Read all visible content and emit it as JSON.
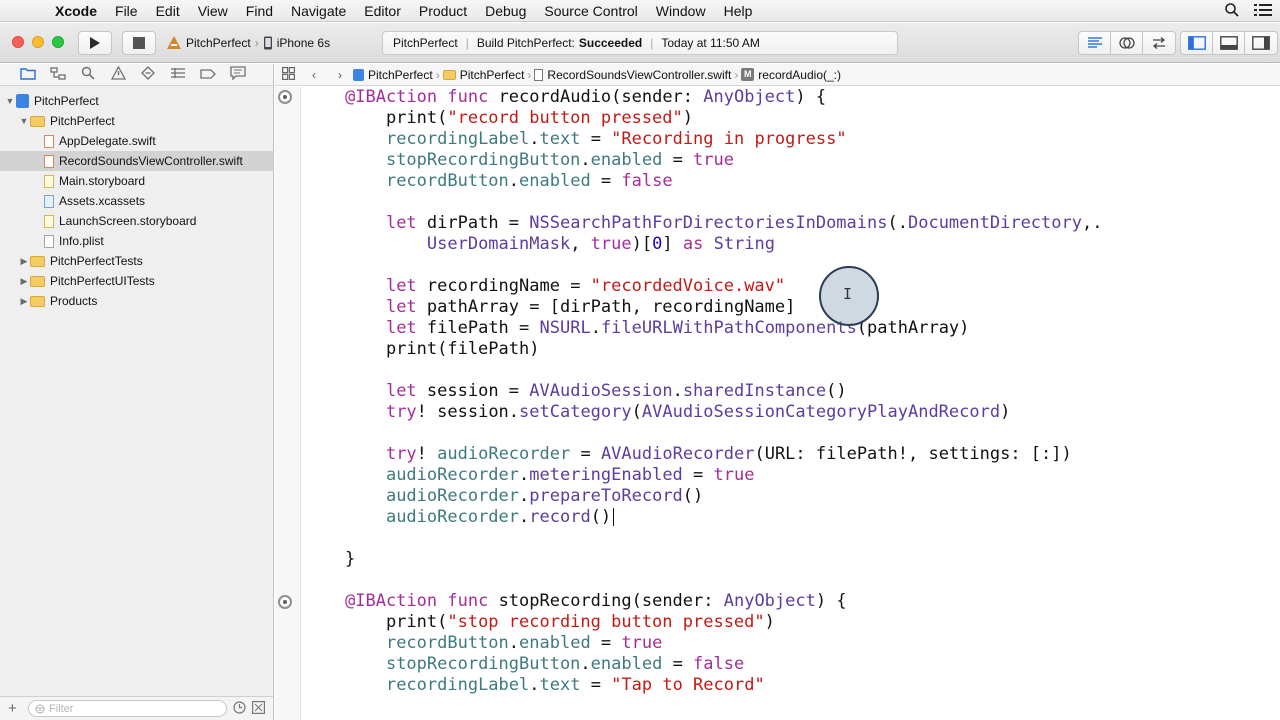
{
  "menubar": {
    "apple_glyph": "",
    "app_name": "Xcode",
    "items": [
      "File",
      "Edit",
      "View",
      "Find",
      "Navigate",
      "Editor",
      "Product",
      "Debug",
      "Source Control",
      "Window",
      "Help"
    ]
  },
  "toolbar": {
    "scheme_target": "PitchPerfect",
    "scheme_device": "iPhone 6s",
    "activity_project": "PitchPerfect",
    "activity_build_label": "Build PitchPerfect:",
    "activity_build_status": "Succeeded",
    "activity_time": "Today at 11:50 AM"
  },
  "navigator": {
    "tree": [
      {
        "label": "PitchPerfect",
        "kind": "project",
        "disclosure": "open",
        "indent": 0
      },
      {
        "label": "PitchPerfect",
        "kind": "folder",
        "disclosure": "open",
        "indent": 1
      },
      {
        "label": "AppDelegate.swift",
        "kind": "swift",
        "disclosure": "",
        "indent": 2
      },
      {
        "label": "RecordSoundsViewController.swift",
        "kind": "swift",
        "disclosure": "",
        "indent": 2,
        "selected": true
      },
      {
        "label": "Main.storyboard",
        "kind": "storyboard",
        "disclosure": "",
        "indent": 2
      },
      {
        "label": "Assets.xcassets",
        "kind": "assets",
        "disclosure": "",
        "indent": 2
      },
      {
        "label": "LaunchScreen.storyboard",
        "kind": "storyboard",
        "disclosure": "",
        "indent": 2
      },
      {
        "label": "Info.plist",
        "kind": "plist",
        "disclosure": "",
        "indent": 2
      },
      {
        "label": "PitchPerfectTests",
        "kind": "folder",
        "disclosure": "closed",
        "indent": 1
      },
      {
        "label": "PitchPerfectUITests",
        "kind": "folder",
        "disclosure": "closed",
        "indent": 1
      },
      {
        "label": "Products",
        "kind": "folder",
        "disclosure": "closed",
        "indent": 1
      }
    ],
    "filter_placeholder": "Filter"
  },
  "jumpbar": {
    "crumbs": [
      "PitchPerfect",
      "PitchPerfect",
      "RecordSoundsViewController.swift",
      "recordAudio(_:)"
    ]
  },
  "editor": {
    "lines": [
      [
        [
          "@IBAction",
          "kw"
        ],
        [
          " ",
          ""
        ],
        [
          "func",
          "kw"
        ],
        [
          " recordAudio(sender: ",
          ""
        ],
        [
          "AnyObject",
          "ty"
        ],
        [
          ") {",
          ""
        ]
      ],
      [
        [
          "    print(",
          ""
        ],
        [
          "\"record button pressed\"",
          "str"
        ],
        [
          ")",
          ""
        ]
      ],
      [
        [
          "    ",
          ""
        ],
        [
          "recordingLabel",
          "prj"
        ],
        [
          ".",
          ""
        ],
        [
          "text",
          "prj"
        ],
        [
          " = ",
          ""
        ],
        [
          "\"Recording in progress\"",
          "str"
        ]
      ],
      [
        [
          "    ",
          ""
        ],
        [
          "stopRecordingButton",
          "prj"
        ],
        [
          ".",
          ""
        ],
        [
          "enabled",
          "prj"
        ],
        [
          " = ",
          ""
        ],
        [
          "true",
          "kw"
        ]
      ],
      [
        [
          "    ",
          ""
        ],
        [
          "recordButton",
          "prj"
        ],
        [
          ".",
          ""
        ],
        [
          "enabled",
          "prj"
        ],
        [
          " = ",
          ""
        ],
        [
          "false",
          "kw"
        ]
      ],
      [],
      [
        [
          "    ",
          ""
        ],
        [
          "let",
          "kw"
        ],
        [
          " dirPath = ",
          ""
        ],
        [
          "NSSearchPathForDirectoriesInDomains",
          "ty"
        ],
        [
          "(.",
          ""
        ],
        [
          "DocumentDirectory",
          "ty"
        ],
        [
          ",.",
          ""
        ]
      ],
      [
        [
          "        ",
          ""
        ],
        [
          "UserDomainMask",
          "ty"
        ],
        [
          ", ",
          ""
        ],
        [
          "true",
          "kw"
        ],
        [
          ")[",
          ""
        ],
        [
          "0",
          "num"
        ],
        [
          "] ",
          ""
        ],
        [
          "as",
          "kw"
        ],
        [
          " ",
          ""
        ],
        [
          "String",
          "ty"
        ]
      ],
      [],
      [
        [
          "    ",
          ""
        ],
        [
          "let",
          "kw"
        ],
        [
          " recordingName = ",
          ""
        ],
        [
          "\"recordedVoice.wav\"",
          "str"
        ]
      ],
      [
        [
          "    ",
          ""
        ],
        [
          "let",
          "kw"
        ],
        [
          " pathArray = [dirPath, recordingName]",
          ""
        ]
      ],
      [
        [
          "    ",
          ""
        ],
        [
          "let",
          "kw"
        ],
        [
          " filePath = ",
          ""
        ],
        [
          "NSURL",
          "ty"
        ],
        [
          ".",
          ""
        ],
        [
          "fileURLWithPathComponents",
          "ty"
        ],
        [
          "(pathArray)",
          ""
        ]
      ],
      [
        [
          "    print(filePath)",
          ""
        ]
      ],
      [],
      [
        [
          "    ",
          ""
        ],
        [
          "let",
          "kw"
        ],
        [
          " session = ",
          ""
        ],
        [
          "AVAudioSession",
          "ty"
        ],
        [
          ".",
          ""
        ],
        [
          "sharedInstance",
          "ty"
        ],
        [
          "()",
          ""
        ]
      ],
      [
        [
          "    ",
          ""
        ],
        [
          "try",
          "kw"
        ],
        [
          "! session.",
          ""
        ],
        [
          "setCategory",
          "ty"
        ],
        [
          "(",
          ""
        ],
        [
          "AVAudioSessionCategoryPlayAndRecord",
          "ty"
        ],
        [
          ")",
          ""
        ]
      ],
      [],
      [
        [
          "    ",
          ""
        ],
        [
          "try",
          "kw"
        ],
        [
          "! ",
          ""
        ],
        [
          "audioRecorder",
          "prj"
        ],
        [
          " = ",
          ""
        ],
        [
          "AVAudioRecorder",
          "ty"
        ],
        [
          "(URL: filePath!, settings: [:])",
          ""
        ]
      ],
      [
        [
          "    ",
          ""
        ],
        [
          "audioRecorder",
          "prj"
        ],
        [
          ".",
          ""
        ],
        [
          "meteringEnabled",
          "ty"
        ],
        [
          " = ",
          ""
        ],
        [
          "true",
          "kw"
        ]
      ],
      [
        [
          "    ",
          ""
        ],
        [
          "audioRecorder",
          "prj"
        ],
        [
          ".",
          ""
        ],
        [
          "prepareToRecord",
          "ty"
        ],
        [
          "()",
          ""
        ]
      ],
      [
        [
          "    ",
          ""
        ],
        [
          "audioRecorder",
          "prj"
        ],
        [
          ".",
          ""
        ],
        [
          "record",
          "ty"
        ],
        [
          "()",
          ""
        ]
      ],
      [],
      [
        [
          "}",
          ""
        ]
      ],
      [],
      [
        [
          "@IBAction",
          "kw"
        ],
        [
          " ",
          ""
        ],
        [
          "func",
          "kw"
        ],
        [
          " stopRecording(sender: ",
          ""
        ],
        [
          "AnyObject",
          "ty"
        ],
        [
          ") {",
          ""
        ]
      ],
      [
        [
          "    print(",
          ""
        ],
        [
          "\"stop recording button pressed\"",
          "str"
        ],
        [
          ")",
          ""
        ]
      ],
      [
        [
          "    ",
          ""
        ],
        [
          "recordButton",
          "prj"
        ],
        [
          ".",
          ""
        ],
        [
          "enabled",
          "prj"
        ],
        [
          " = ",
          ""
        ],
        [
          "true",
          "kw"
        ]
      ],
      [
        [
          "    ",
          ""
        ],
        [
          "stopRecordingButton",
          "prj"
        ],
        [
          ".",
          ""
        ],
        [
          "enabled",
          "prj"
        ],
        [
          " = ",
          ""
        ],
        [
          "false",
          "kw"
        ]
      ],
      [
        [
          "    ",
          ""
        ],
        [
          "recordingLabel",
          "prj"
        ],
        [
          ".",
          ""
        ],
        [
          "text",
          "prj"
        ],
        [
          " = ",
          ""
        ],
        [
          "\"Tap to Record\"",
          "str"
        ]
      ]
    ],
    "cursor_line": 20
  }
}
